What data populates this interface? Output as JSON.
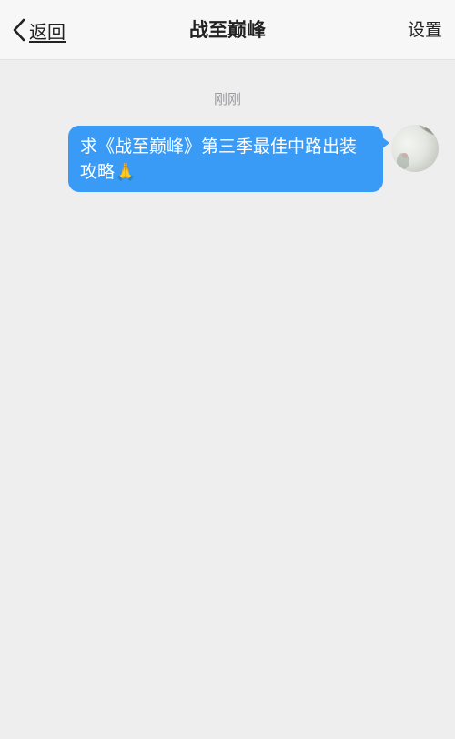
{
  "navbar": {
    "back_label": "返回",
    "title": "战至巅峰",
    "settings_label": "设置"
  },
  "chat": {
    "timestamp": "刚刚",
    "messages": [
      {
        "sender": "me",
        "text": "求《战至巅峰》第三季最佳中路出装攻略🙏"
      }
    ]
  },
  "colors": {
    "bubble": "#3a9bf7",
    "background": "#eeeeef",
    "navbar": "#f7f7f8"
  },
  "icons": {
    "back": "chevron-left-icon"
  }
}
